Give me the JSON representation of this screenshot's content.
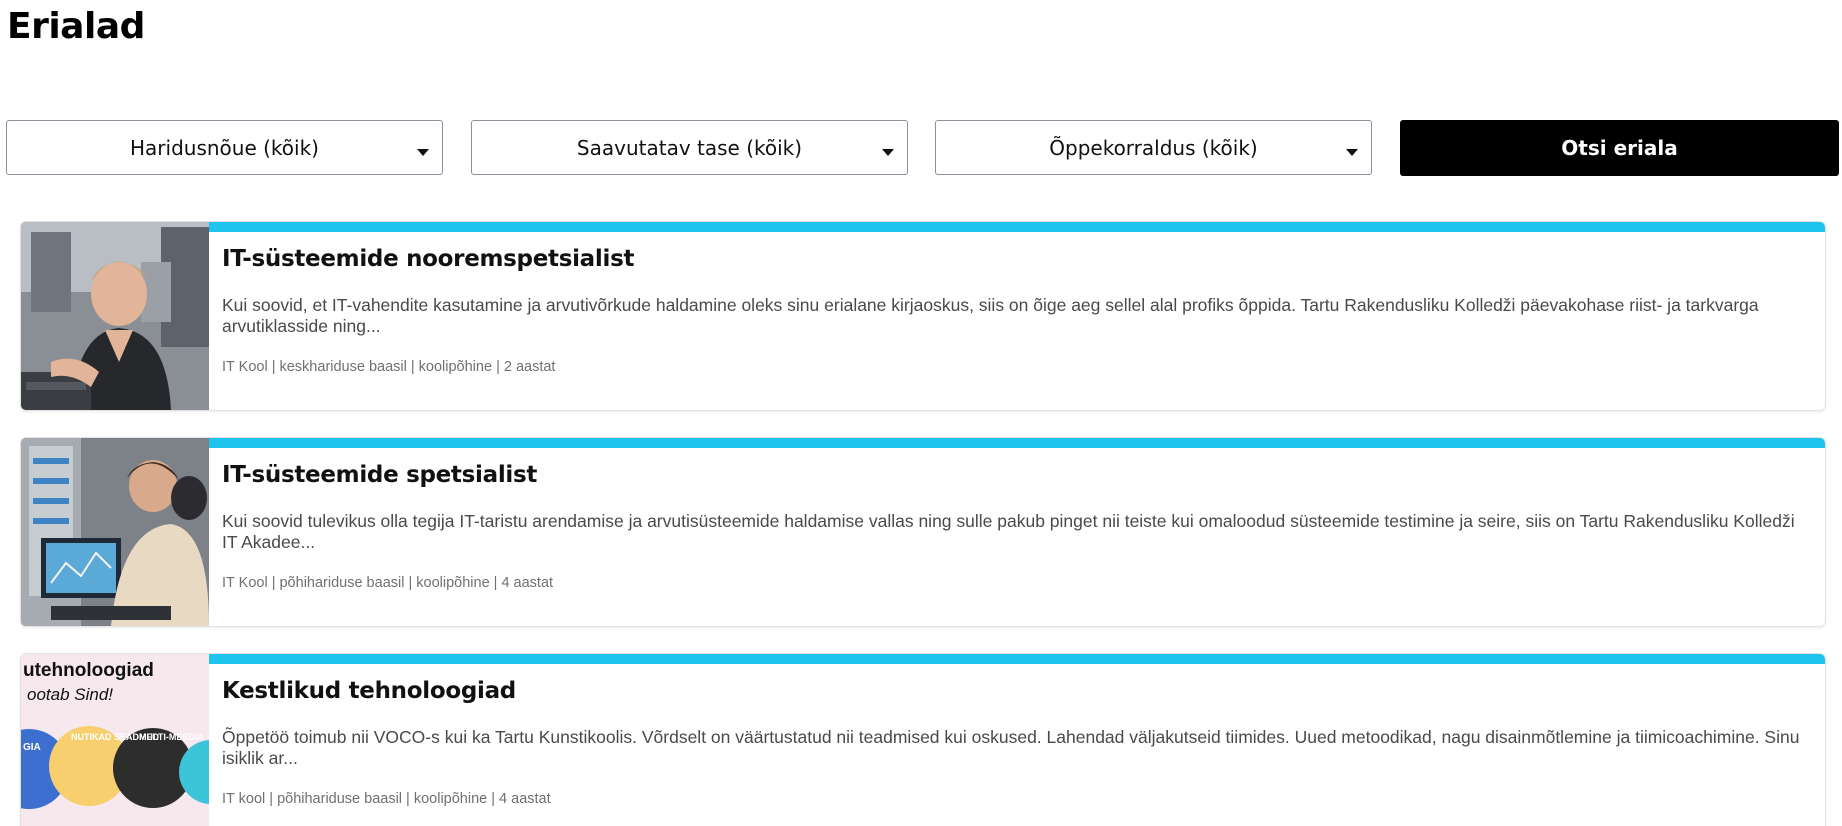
{
  "page": {
    "title": "Erialad"
  },
  "filters": {
    "education_requirement": "Haridusnõue (kõik)",
    "achievable_level": "Saavutatav tase (kõik)",
    "study_form": "Õppekorraldus (kõik)",
    "search_button": "Otsi eriala"
  },
  "colors": {
    "accent_bar": "#1ec3ee",
    "button_bg": "#000000"
  },
  "programs": [
    {
      "title": "IT-süsteemide nooremspetsialist",
      "description": "Kui soovid, et IT-vahendite kasutamine ja arvutivõrkude haldamine oleks sinu erialane kirjaoskus, siis on õige aeg sellel alal profiks õppida. Tartu Rakendusliku Kolledži päevakohase riist- ja tarkvarga arvutiklasside ning...",
      "meta": "IT Kool | keskhariduse baasil | koolipõhine | 2 aastat",
      "image": "photo-student-at-computer"
    },
    {
      "title": "IT-süsteemide spetsialist",
      "description": "Kui soovid tulevikus olla tegija IT-taristu arendamise ja arvutisüsteemide haldamise vallas ning sulle pakub pinget nii teiste kui omaloodud süsteemide testimine ja seire, siis on Tartu Rakendusliku Kolledži IT Akadee...",
      "meta": "IT Kool | põhihariduse baasil | koolipõhine | 4 aastat",
      "image": "photo-students-at-monitors"
    },
    {
      "title": "Kestlikud tehnoloogiad",
      "description": "Õppetöö toimub nii VOCO-s kui ka Tartu Kunstikoolis. Võrdselt on väärtustatud nii teadmised kui oskused. Lahendad väljakutseid tiimides. Uued metoodikad, nagu disainmõtlemine ja tiimicoachimine. Sinu isiklik ar...",
      "meta": "IT kool | põhihariduse baasil | koolipõhine | 4 aastat",
      "image": "poster-kestlikud-tehnoloogiad",
      "thumb_text": {
        "headline": "utehnoloogiad",
        "subline": "ootab Sind!",
        "circle_1": "GIA",
        "circle_2": "NUTIKAD SEADMED",
        "circle_3": "MULTI-MEEDIA"
      }
    }
  ]
}
